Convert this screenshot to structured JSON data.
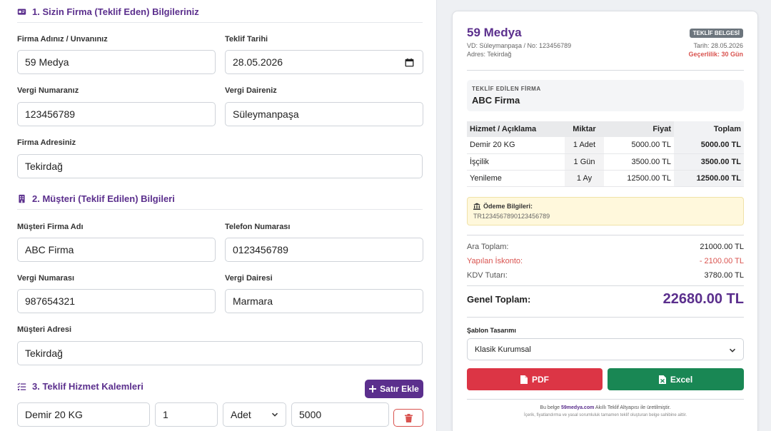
{
  "sections": {
    "s1": "1. Sizin Firma (Teklif Eden) Bilgileriniz",
    "s2": "2. Müşteri (Teklif Edilen) Bilgileri",
    "s3": "3. Teklif Hizmet Kalemleri"
  },
  "seller": {
    "name_label": "Firma Adınız / Unvanınız",
    "name": "59 Medya",
    "date_label": "Teklif Tarihi",
    "date": "28.05.2026",
    "tax_no_label": "Vergi Numaranız",
    "tax_no": "123456789",
    "tax_office_label": "Vergi Daireniz",
    "tax_office": "Süleymanpaşa",
    "address_label": "Firma Adresiniz",
    "address": "Tekirdağ"
  },
  "client": {
    "name_label": "Müşteri Firma Adı",
    "name": "ABC Firma",
    "phone_label": "Telefon Numarası",
    "phone": "0123456789",
    "tax_no_label": "Vergi Numarası",
    "tax_no": "987654321",
    "tax_office_label": "Vergi Dairesi",
    "tax_office": "Marmara",
    "address_label": "Müşteri Adresi",
    "address": "Tekirdağ"
  },
  "items_form": {
    "add_label": "Satır Ekle",
    "row": {
      "desc": "Demir 20 KG",
      "qty": "1",
      "unit": "Adet",
      "price": "5000"
    }
  },
  "preview": {
    "company": "59 Medya",
    "tax_line": "VD: Süleymanpaşa / No: 123456789",
    "address_line": "Adres: Tekirdağ",
    "badge": "TEKLİF BELGESİ",
    "date_line": "Tarih: 28.05.2026",
    "validity": "Geçerlilik: 30 Gün",
    "client_label": "TEKLİF EDİLEN FİRMA",
    "client_name": "ABC Firma",
    "table_headers": [
      "Hizmet / Açıklama",
      "Miktar",
      "Fiyat",
      "Toplam"
    ],
    "rows": [
      [
        "Demir 20 KG",
        "1 Adet",
        "5000.00 TL",
        "5000.00 TL"
      ],
      [
        "İşçilik",
        "1 Gün",
        "3500.00 TL",
        "3500.00 TL"
      ],
      [
        "Yenileme",
        "1 Ay",
        "12500.00 TL",
        "12500.00 TL"
      ]
    ],
    "payment_title": "Ödeme Bilgileri:",
    "iban": "TR1234567890123456789",
    "subtotal_label": "Ara Toplam:",
    "subtotal": "21000.00 TL",
    "discount_label": "Yapılan İskonto:",
    "discount": "- 2100.00 TL",
    "vat_label": "KDV Tutarı:",
    "vat": "3780.00 TL",
    "grand_label": "Genel Toplam:",
    "grand": "22680.00 TL",
    "template_label": "Şablon Tasarımı",
    "template_value": "Klasik Kurumsal",
    "pdf_label": "PDF",
    "excel_label": "Excel",
    "footer_pre": "Bu belge",
    "footer_brand": "59medya.com",
    "footer_post": "Akıllı Teklif Altyapısı ile üretilmiştir.",
    "footer_note": "İçerik, fiyatlandırma ve yasal sorumluluk tamamen teklif oluşturan belge sahibine aittir."
  },
  "colors": {
    "accent": "#5b2f8d",
    "pdf": "#dc3545",
    "excel": "#198754",
    "danger": "#d9534f"
  }
}
